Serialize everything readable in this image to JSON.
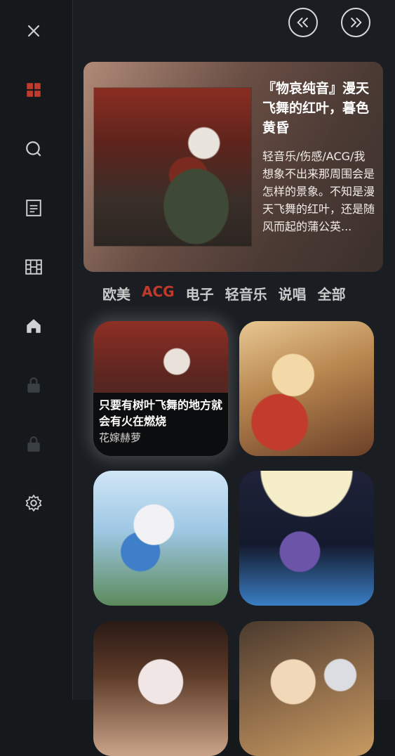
{
  "sidebar": {
    "icons": [
      "close-icon",
      "grid-icon",
      "search-icon",
      "document-icon",
      "film-icon",
      "home-icon",
      "lock-icon",
      "lock-icon",
      "gear-icon"
    ],
    "active_color": "#c0392b"
  },
  "nav": {
    "prev_icon": "double-chevron-left-icon",
    "next_icon": "double-chevron-right-icon"
  },
  "featured": {
    "title": "『物哀纯音』漫天飞舞的红叶，暮色黄昏",
    "description": "轻音乐/伤感/ACG/我想象不出来那周围会是怎样的景象。不知是漫天飞舞的红叶，还是随风而起的蒲公英..."
  },
  "tabs": [
    "欧美",
    "ACG",
    "电子",
    "轻音乐",
    "说唱",
    "全部"
  ],
  "active_tab": "ACG",
  "cards": [
    {
      "title": "只要有树叶飞舞的地方就会有火在燃烧",
      "artist": "花嫁赫萝"
    }
  ]
}
